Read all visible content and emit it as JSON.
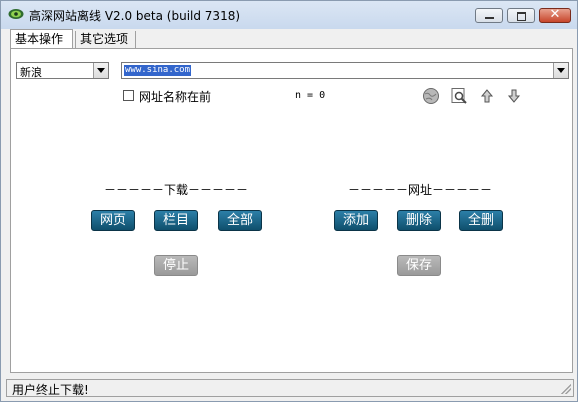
{
  "window": {
    "title": "高深网站离线 V2.0 beta (build 7318)"
  },
  "tabs": [
    {
      "label": "基本操作",
      "active": true
    },
    {
      "label": "其它选项",
      "active": false
    }
  ],
  "source_select": {
    "value": "新浪"
  },
  "url_field": {
    "value": "www.sina.com"
  },
  "options": {
    "checkbox_label": "网址名称在前",
    "checked": false,
    "n_text": "n = 0"
  },
  "download": {
    "header": "－－－－－下载－－－－－",
    "buttons": [
      "网页",
      "栏目",
      "全部"
    ],
    "stop": "停止"
  },
  "url_section": {
    "header": "－－－－－网址－－－－－",
    "buttons": [
      "添加",
      "删除",
      "全删"
    ],
    "save": "保存"
  },
  "status": {
    "text": "用户终止下载!"
  },
  "colors": {
    "button": "#1a6285",
    "disabled_button": "#a8a8a8",
    "selection": "#3366cc"
  },
  "icons": [
    "app-icon",
    "minimize-icon",
    "maximize-icon",
    "close-icon",
    "globe-icon",
    "search-page-icon",
    "arrow-up-icon",
    "arrow-down-icon"
  ]
}
